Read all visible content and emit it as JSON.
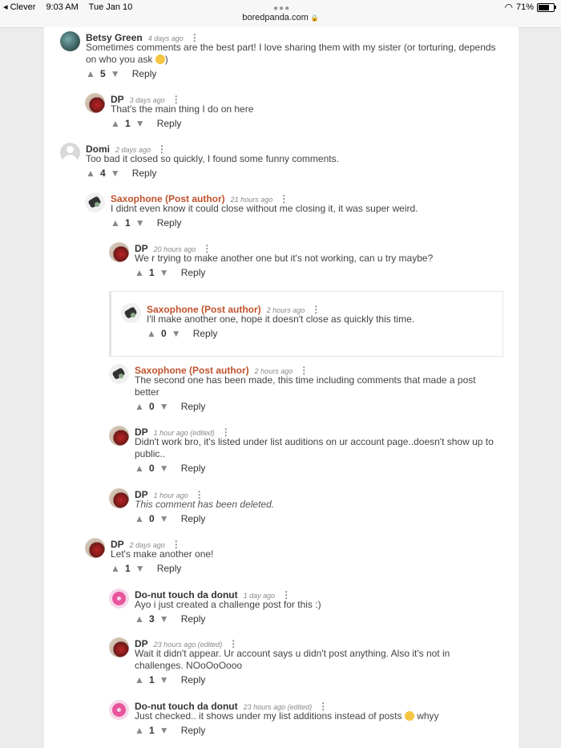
{
  "status": {
    "back_app": "◂ Clever",
    "time": "9:03 AM",
    "date": "Tue Jan 10",
    "battery": "71%",
    "battery_level": 0.71,
    "url": "boredpanda.com"
  },
  "comments": [
    {
      "author": "Betsy Green",
      "post_author": false,
      "time": "4 days ago",
      "text": "Sometimes comments are the best part! I love sharing them with my sister (or torturing, depends",
      "text2": "on who you ask",
      "score": "5",
      "avatar": "betsy"
    },
    {
      "author": "DP",
      "post_author": false,
      "time": "3 days ago",
      "text": "That's the main thing I do on here",
      "score": "1",
      "avatar": "dp"
    },
    {
      "author": "Domi",
      "post_author": false,
      "time": "2 days ago",
      "text": "Too bad it closed so quickly, I found some funny comments.",
      "score": "4",
      "avatar": "domi"
    },
    {
      "author": "Saxophone (Post author)",
      "post_author": true,
      "time": "21 hours ago",
      "text": "I didnt even know it could close without me closing it, it was super weird.",
      "score": "1",
      "avatar": "sax"
    },
    {
      "author": "DP",
      "post_author": false,
      "time": "20 hours ago",
      "text": "We r trying to make another one but it's not working, can u try maybe?",
      "score": "1",
      "avatar": "dp"
    },
    {
      "author": "Saxophone (Post author)",
      "post_author": true,
      "time": "2 hours ago",
      "text": "I'll make another one, hope it doesn't close as quickly this time.",
      "score": "0",
      "avatar": "sax"
    },
    {
      "author": "Saxophone (Post author)",
      "post_author": true,
      "time": "2 hours ago",
      "text": "The second one has been made, this time including comments that made a post",
      "text2": "better",
      "score": "0",
      "avatar": "sax"
    },
    {
      "author": "DP",
      "post_author": false,
      "time": "1 hour ago  (edited)",
      "text": "Didn't work bro, it's listed under list auditions on ur account page..doesn't show up to",
      "text2": "public..",
      "score": "0",
      "avatar": "dp"
    },
    {
      "author": "DP",
      "post_author": false,
      "time": "1 hour ago",
      "text": "This comment has been deleted.",
      "deleted": true,
      "score": "0",
      "avatar": "dp"
    },
    {
      "author": "DP",
      "post_author": false,
      "time": "2 days ago",
      "text": "Let's make another one!",
      "score": "1",
      "avatar": "dp"
    },
    {
      "author": "Do-nut touch da donut",
      "post_author": false,
      "time": "1 day ago",
      "text": "Ayo i just created a challenge post for this :)",
      "score": "3",
      "avatar": "donut"
    },
    {
      "author": "DP",
      "post_author": false,
      "time": "23 hours ago  (edited)",
      "text": "Wait it didn't appear. Ur account says u didn't post anything. Also it's not in",
      "text2": "challenges. NOoOoOooo",
      "score": "1",
      "avatar": "dp"
    },
    {
      "author": "Do-nut touch da donut",
      "post_author": false,
      "time": "23 hours ago  (edited)",
      "text": "Just checked.. it shows under my list additions instead of posts",
      "text_suffix": "whyy",
      "score": "1",
      "avatar": "donut"
    }
  ],
  "labels": {
    "reply": "Reply"
  },
  "icons": {
    "upvote": "up-arrow-icon",
    "downvote": "down-arrow-icon",
    "more": "kebab-menu-icon"
  }
}
